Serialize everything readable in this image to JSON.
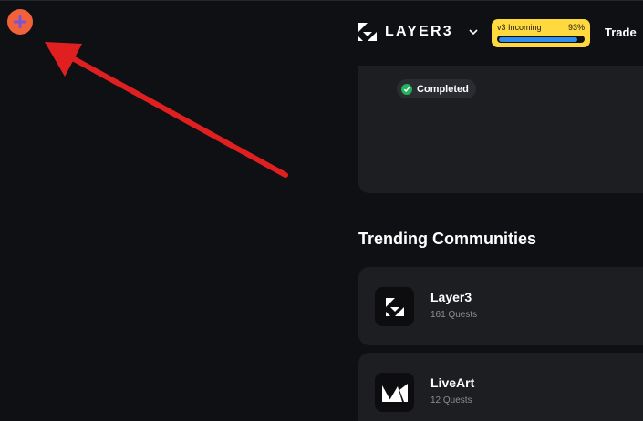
{
  "header": {
    "brand": "LAYER3",
    "badge": {
      "label": "v3 Incoming",
      "percent_text": "93%",
      "progress": 0.93
    },
    "nav_trade": "Trade"
  },
  "card": {
    "status": "Completed"
  },
  "trending": {
    "title": "Trending Communities",
    "communities": [
      {
        "name": "Layer3",
        "quests": "161 Quests"
      },
      {
        "name": "LiveArt",
        "quests": "12 Quests"
      }
    ]
  },
  "colors": {
    "background": "#0f1014",
    "card": "#1d1e22",
    "badge": "#ffd93d",
    "progress": "#2f8ef0",
    "arrow": "#e02020",
    "extension": "#f0623a",
    "completed": "#22b35c"
  },
  "icons": {
    "extension": "plus-icon",
    "annotation": "arrow-annotation",
    "chevron": "chevron-down-icon",
    "check": "check-circle-icon"
  }
}
